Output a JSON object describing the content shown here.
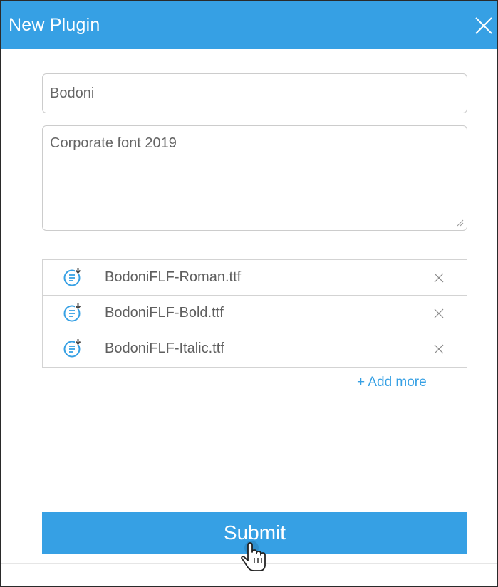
{
  "dialog": {
    "title": "New Plugin",
    "close_icon": "close-icon"
  },
  "form": {
    "name_value": "Bodoni",
    "description_value": "Corporate font 2019"
  },
  "files": [
    {
      "name": "BodoniFLF-Roman.ttf",
      "icon": "font-file-icon"
    },
    {
      "name": "BodoniFLF-Bold.ttf",
      "icon": "font-file-icon"
    },
    {
      "name": "BodoniFLF-Italic.ttf",
      "icon": "font-file-icon"
    }
  ],
  "add_more_label": "+ Add more",
  "submit_label": "Submit",
  "colors": {
    "accent": "#36a0e4",
    "border": "#cccccc",
    "text": "#5f5f5f"
  }
}
